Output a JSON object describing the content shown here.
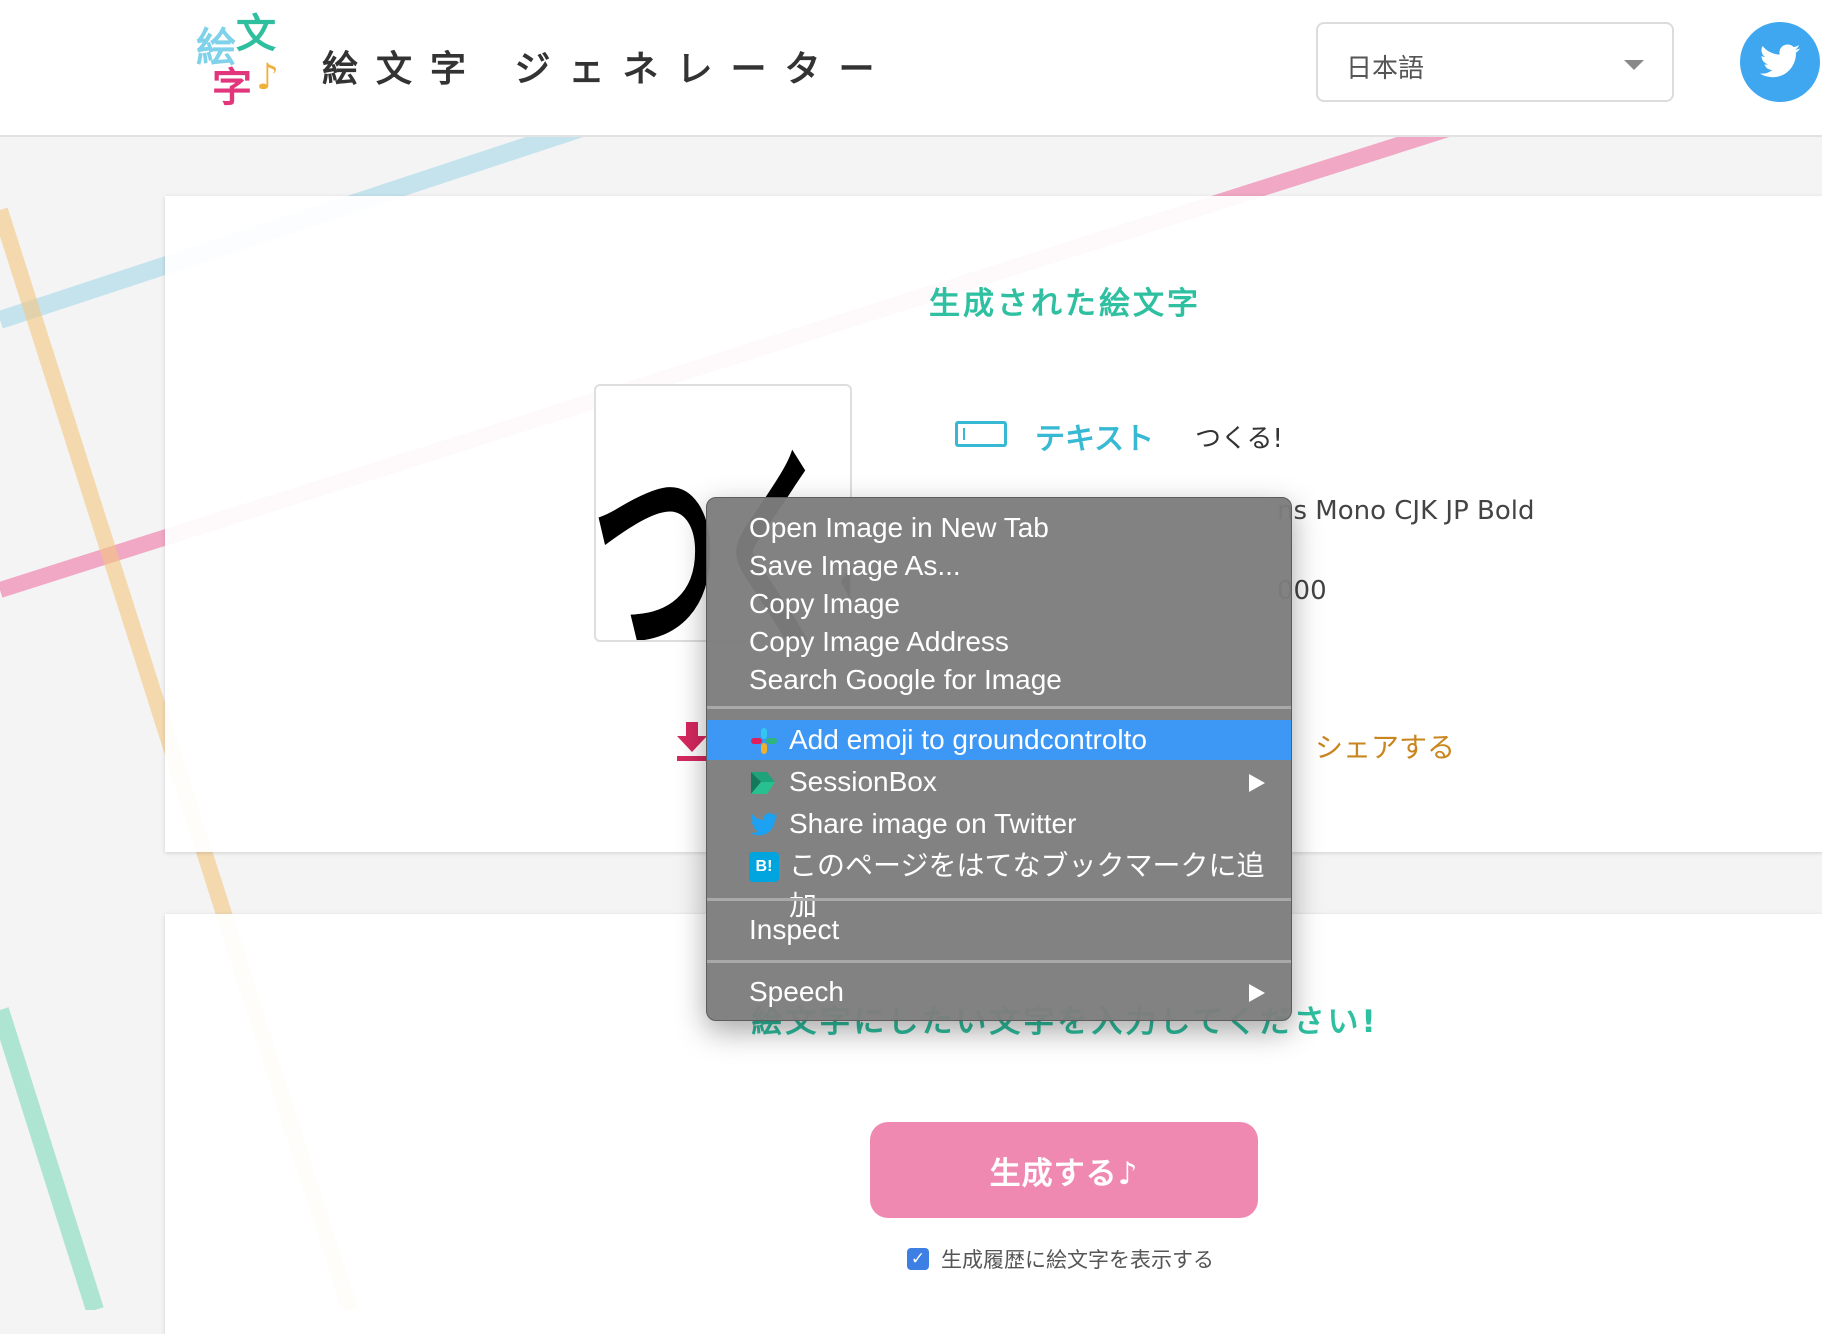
{
  "header": {
    "logo_chars": [
      "絵",
      "文",
      "字",
      "♪"
    ],
    "site_title": "絵文字 ジェネレーター",
    "language": "日本語"
  },
  "result": {
    "title": "生成された絵文字",
    "preview_text": "つくる!",
    "text_label": "テキスト",
    "text_value": "つくる!",
    "font_value_partial": "ns Mono CJK JP Bold",
    "color_value_partial": "000",
    "share_label": "シェアする"
  },
  "form": {
    "title": "絵文字にしたい文字を入力してください!",
    "generate_button": "生成する♪",
    "history_checkbox_label": "生成履歴に絵文字を表示する",
    "history_checked": true
  },
  "context_menu": {
    "items": [
      {
        "label": "Open Image in New Tab"
      },
      {
        "label": "Save Image As..."
      },
      {
        "label": "Copy Image"
      },
      {
        "label": "Copy Image Address"
      },
      {
        "label": "Search Google for Image"
      },
      {
        "label": "Add emoji to groundcontrolto",
        "icon": "slack-icon",
        "highlighted": true
      },
      {
        "label": "SessionBox",
        "icon": "sessionbox-icon",
        "submenu": true
      },
      {
        "label": "Share image on Twitter",
        "icon": "twitter-icon"
      },
      {
        "label": "このページをはてなブックマークに追加",
        "icon": "hatena-bookmark-icon"
      },
      {
        "label": "Inspect"
      },
      {
        "label": "Speech",
        "submenu": true
      }
    ],
    "hatena_icon_text": "B!"
  },
  "colors": {
    "accent_teal": "#2ec0a0",
    "text_blue": "#38b9d3",
    "share_gold": "#c9851e",
    "generate_pink": "#ef89b1",
    "menu_highlight": "#3d97f5",
    "twitter_blue": "#3fa7f0"
  }
}
